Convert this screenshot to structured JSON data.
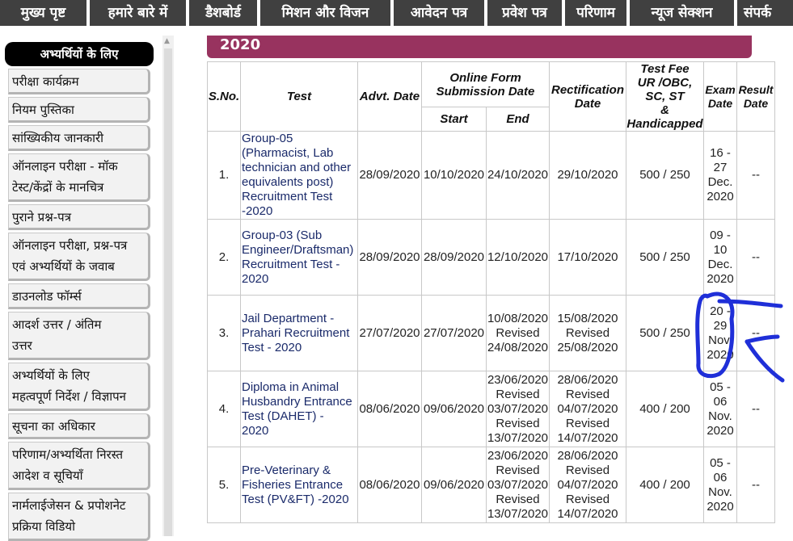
{
  "nav": {
    "items": [
      "मुख्य पृष्ट",
      "हमारे बारे में",
      "डैशबोर्ड",
      "मिशन और विजन",
      "आवेदन पत्र",
      "प्रवेश पत्र",
      "परिणाम",
      "न्यूज सेक्शन",
      "संपर्क"
    ]
  },
  "sidebar": {
    "heading": "अभ्यर्थियों के लिए",
    "items": [
      [
        "परीक्षा कार्यक्रम"
      ],
      [
        "नियम पुस्तिका"
      ],
      [
        "सांख्यिकीय जानकारी"
      ],
      [
        "ऑनलाइन परीक्षा - मॉक",
        "टेस्ट/केंद्रों के मानचित्र"
      ],
      [
        "पुराने प्रश्न-पत्र"
      ],
      [
        "ऑनलाइन परीक्षा, प्रश्न-पत्र",
        "एवं अभ्यर्थियों के जवाब"
      ],
      [
        "डाउनलोड फॉर्म्स"
      ],
      [
        "आदर्श उत्तर / अंतिम",
        "उत्तर"
      ],
      [
        "अभ्यर्थियों के लिए",
        "महत्वपूर्ण निर्देश / विज्ञापन"
      ],
      [
        "सूचना का अधिकार"
      ],
      [
        "परिणाम/अभ्यर्थिता निरस्त",
        "आदेश व सूचियाँ"
      ],
      [
        "नार्मलाईजेसन & प्रपोशनेट",
        "प्रक्रिया विडियो"
      ]
    ]
  },
  "year": "2020",
  "table": {
    "headers": {
      "sno": "S.No.",
      "test": "Test",
      "advt": "Advt. Date",
      "online": [
        "Online Form",
        "Submission Date"
      ],
      "start": "Start",
      "end": "End",
      "rect": [
        "Rectification",
        "Date"
      ],
      "fee": [
        "Test Fee",
        "UR /OBC,",
        "SC,  ST",
        "&",
        "Handicapped"
      ],
      "exam": [
        "Exam",
        "Date"
      ],
      "result": [
        "Result",
        "Date"
      ]
    },
    "rows": [
      {
        "sno": "1.",
        "test": [
          "Group-05",
          "(Pharmacist, Lab",
          "technician and other",
          "equivalents post)",
          "Recruitment Test",
          "-2020"
        ],
        "advt": "28/09/2020",
        "start": "10/10/2020",
        "end": [
          "24/10/2020"
        ],
        "rect": [
          "29/10/2020"
        ],
        "fee": "500 / 250",
        "exam": [
          "16 -",
          "27",
          "Dec.",
          "2020"
        ],
        "result": "--"
      },
      {
        "sno": "2.",
        "test": [
          "Group-03 (Sub",
          "Engineer/Draftsman)",
          "Recruitment Test -",
          "2020"
        ],
        "advt": "28/09/2020",
        "start": "28/09/2020",
        "end": [
          "12/10/2020"
        ],
        "rect": [
          "17/10/2020"
        ],
        "fee": "500 / 250",
        "exam": [
          "09 -",
          "10",
          "Dec.",
          "2020"
        ],
        "result": "--"
      },
      {
        "sno": "3.",
        "test": [
          "Jail Department -",
          "Prahari Recruitment",
          "Test - 2020"
        ],
        "advt": "27/07/2020",
        "start": "27/07/2020",
        "end": [
          "10/08/2020",
          "Revised",
          "24/08/2020"
        ],
        "rect": [
          "15/08/2020",
          "Revised",
          "25/08/2020"
        ],
        "fee": "500 / 250",
        "exam": [
          "20 -",
          "29",
          "Nov.",
          "2020"
        ],
        "result": "--"
      },
      {
        "sno": "4.",
        "test": [
          "Diploma in Animal",
          "Husbandry Entrance",
          "Test (DAHET)  -",
          "2020"
        ],
        "advt": "08/06/2020",
        "start": "09/06/2020",
        "end": [
          "23/06/2020",
          "Revised",
          "03/07/2020",
          "Revised",
          "13/07/2020"
        ],
        "rect": [
          "28/06/2020",
          "Revised",
          "04/07/2020",
          "Revised",
          "14/07/2020"
        ],
        "fee": "400 / 200",
        "exam": [
          "05 -",
          "06",
          "Nov.",
          "2020"
        ],
        "result": "--"
      },
      {
        "sno": "5.",
        "test": [
          "Pre-Veterinary &",
          "Fisheries Entrance",
          "Test (PV&FT) -2020"
        ],
        "advt": "08/06/2020",
        "start": "09/06/2020",
        "end": [
          "23/06/2020",
          "Revised",
          "03/07/2020",
          "Revised",
          "13/07/2020"
        ],
        "rect": [
          "28/06/2020",
          "Revised",
          "04/07/2020",
          "Revised",
          "14/07/2020"
        ],
        "fee": "400 / 200",
        "exam": [
          "05 -",
          "06",
          "Nov.",
          "2020"
        ],
        "result": "--"
      }
    ]
  },
  "colors": {
    "nav_bg": "#404040",
    "year_bar": "#98335f",
    "annotation": "#1f2fd8"
  }
}
